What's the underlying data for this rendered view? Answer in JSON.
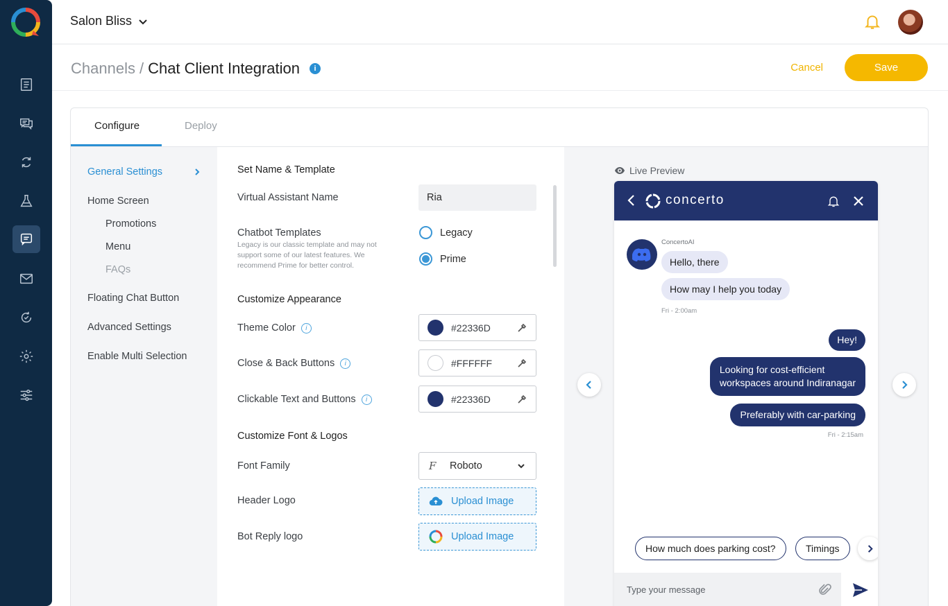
{
  "colors": {
    "rail": "#0f2a44",
    "accent": "#2a8fd3",
    "save": "#f5b800",
    "theme": "#22336D",
    "white": "#FFFFFF"
  },
  "topbar": {
    "org_name": "Salon Bliss"
  },
  "rail": {
    "items": [
      "document-icon",
      "chat-icon",
      "loop-icon",
      "flask-icon",
      "chat-preview-icon",
      "mail-icon",
      "cycle-icon",
      "gear-icon",
      "sliders-icon"
    ]
  },
  "header": {
    "crumb_parent": "Channels",
    "crumb_sep": "/",
    "crumb_current": "Chat Client Integration",
    "info_glyph": "i",
    "cancel_label": "Cancel",
    "save_label": "Save"
  },
  "tabs": [
    {
      "label": "Configure"
    },
    {
      "label": "Deploy"
    }
  ],
  "sidenav": {
    "items": [
      {
        "label": "General Settings"
      },
      {
        "label": "Home Screen"
      },
      {
        "label": "Promotions"
      },
      {
        "label": "Menu"
      },
      {
        "label": "FAQs"
      },
      {
        "label": "Floating Chat Button"
      },
      {
        "label": "Advanced Settings"
      },
      {
        "label": "Enable Multi Selection"
      }
    ]
  },
  "form": {
    "sec_name": "Set Name & Template",
    "va_name_label": "Virtual Assistant Name",
    "va_name_value": "Ria",
    "templates_label": "Chatbot Templates",
    "templates_help": "Legacy is our classic template and may not support some of our latest features. We recommend Prime for better control.",
    "radio_legacy": "Legacy",
    "radio_prime": "Prime",
    "sec_appearance": "Customize Appearance",
    "theme_label": "Theme Color",
    "theme_value": "#22336D",
    "close_label": "Close & Back Buttons",
    "close_value": "#FFFFFF",
    "clickable_label": "Clickable Text and Buttons",
    "clickable_value": "#22336D",
    "sec_font": "Customize Font & Logos",
    "font_label": "Font Family",
    "font_value": "Roboto",
    "header_logo_label": "Header Logo",
    "bot_logo_label": "Bot Reply logo",
    "upload_label": "Upload Image"
  },
  "preview": {
    "label": "Live Preview",
    "brand": "concerto",
    "bot_name": "ConcertoAI",
    "msg_in_1": "Hello, there",
    "msg_in_2": "How may I help you today",
    "time_in": "Fri - 2:00am",
    "msg_out_1": "Hey!",
    "msg_out_2_line1": "Looking for cost-efficient",
    "msg_out_2_line2": "workspaces around Indiranagar",
    "msg_out_3": "Preferably with car-parking",
    "time_out": "Fri - 2:15am",
    "chip_1": "How much does parking cost?",
    "chip_2": "Timings",
    "composer_placeholder": "Type your message"
  }
}
